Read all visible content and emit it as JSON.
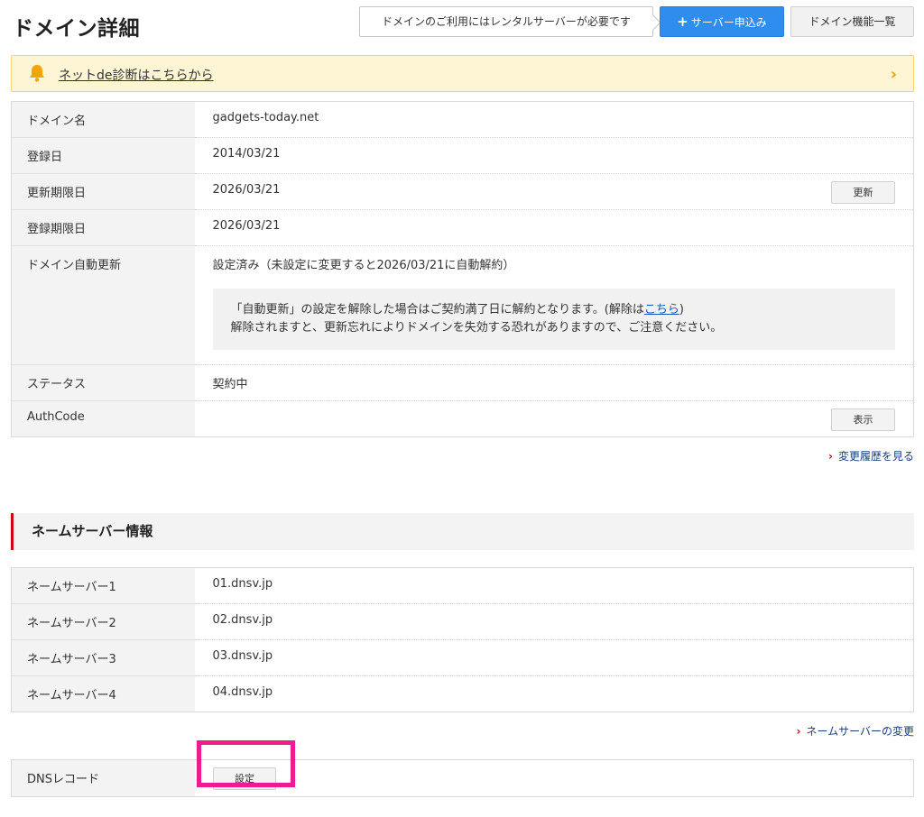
{
  "header": {
    "title": "ドメイン詳細",
    "callout": "ドメインのご利用にはレンタルサーバーが必要です",
    "server_apply_label": "サーバー申込み",
    "domain_functions_label": "ドメイン機能一覧"
  },
  "alert": {
    "text": "ネットde診断はこちらから"
  },
  "domain_info": {
    "domain_name_label": "ドメイン名",
    "domain_name": "gadgets-today.net",
    "registered_label": "登録日",
    "registered": "2014/03/21",
    "renewal_deadline_label": "更新期限日",
    "renewal_deadline": "2026/03/21",
    "renew_button": "更新",
    "registration_deadline_label": "登録期限日",
    "registration_deadline": "2026/03/21",
    "auto_renew_label": "ドメイン自動更新",
    "auto_renew_status": "設定済み（未設定に変更すると2026/03/21に自動解約）",
    "auto_renew_note_1": "「自動更新」の設定を解除した場合はご契約満了日に解約となります。(解除は",
    "auto_renew_note_link": "こちら",
    "auto_renew_note_1_end": ")",
    "auto_renew_note_2": "解除されますと、更新忘れによりドメインを失効する恐れがありますので、ご注意ください。",
    "status_label": "ステータス",
    "status": "契約中",
    "authcode_label": "AuthCode",
    "show_button": "表示"
  },
  "change_history_link": "変更履歴を見る",
  "nameserver_section": {
    "heading": "ネームサーバー情報",
    "rows": [
      {
        "label": "ネームサーバー1",
        "value": "01.dnsv.jp"
      },
      {
        "label": "ネームサーバー2",
        "value": "02.dnsv.jp"
      },
      {
        "label": "ネームサーバー3",
        "value": "03.dnsv.jp"
      },
      {
        "label": "ネームサーバー4",
        "value": "04.dnsv.jp"
      }
    ],
    "change_link": "ネームサーバーの変更"
  },
  "dns": {
    "label": "DNSレコード",
    "settings_button": "設定"
  },
  "colors": {
    "primary_blue": "#2e8def",
    "alert_bg": "#fdf5d3",
    "accent_red": "#d0021b",
    "highlight_pink": "#ee1d8f"
  }
}
